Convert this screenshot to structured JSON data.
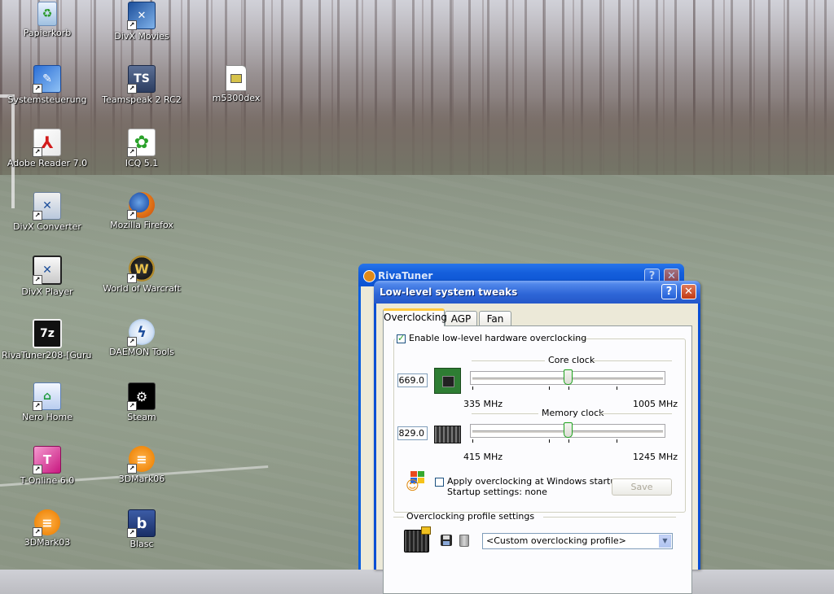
{
  "desktop": {
    "icons": [
      {
        "label": "Papierkorb",
        "icon": "recycle-bin-icon"
      },
      {
        "label": "DivX Movies",
        "icon": "divx-movies-icon"
      },
      {
        "label": "Systemsteuerung",
        "icon": "control-panel-icon"
      },
      {
        "label": "Teamspeak 2 RC2",
        "icon": "teamspeak-icon"
      },
      {
        "label": "m5300dex",
        "icon": "document-icon"
      },
      {
        "label": "Adobe Reader 7.0",
        "icon": "adobe-reader-icon"
      },
      {
        "label": "ICQ 5.1",
        "icon": "icq-flower-icon"
      },
      {
        "label": "DivX Converter",
        "icon": "divx-converter-icon"
      },
      {
        "label": "Mozilla Firefox",
        "icon": "firefox-icon"
      },
      {
        "label": "DivX Player",
        "icon": "divx-player-icon"
      },
      {
        "label": "World of Warcraft",
        "icon": "wow-icon"
      },
      {
        "label": "RivaTuner208-[Guru...",
        "icon": "7z-archive-icon"
      },
      {
        "label": "DAEMON Tools",
        "icon": "daemon-tools-icon"
      },
      {
        "label": "Nero Home",
        "icon": "nero-home-icon"
      },
      {
        "label": "Steam",
        "icon": "steam-icon"
      },
      {
        "label": "T-Online 6.0",
        "icon": "t-online-icon"
      },
      {
        "label": "3DMark06",
        "icon": "3dmark-icon"
      },
      {
        "label": "3DMark03",
        "icon": "3dmark-icon"
      },
      {
        "label": "Blasc",
        "icon": "blasc-icon"
      }
    ]
  },
  "background_window": {
    "title": "RivaTuner",
    "help_glyph": "?",
    "close_glyph": "✕"
  },
  "dialog": {
    "title": "Low-level system tweaks",
    "help_glyph": "?",
    "close_glyph": "✕",
    "tabs": [
      {
        "label": "Overclocking",
        "active": true
      },
      {
        "label": "AGP",
        "active": false
      },
      {
        "label": "Fan",
        "active": false
      }
    ],
    "enable_overclocking": {
      "label": "Enable low-level hardware overclocking",
      "checked": true
    },
    "core_clock": {
      "label": "Core clock",
      "value": "669.0",
      "min_label": "335 MHz",
      "max_label": "1005 MHz",
      "fraction": 0.5
    },
    "memory_clock": {
      "label": "Memory clock",
      "value": "829.0",
      "min_label": "415 MHz",
      "max_label": "1245 MHz",
      "fraction": 0.5
    },
    "apply_startup": {
      "label": "Apply overclocking at Windows startup",
      "checked": false
    },
    "startup_settings": "Startup settings: none",
    "save_button": "Save",
    "profile_section_label": "Overclocking profile settings",
    "profile_select": {
      "selected": "<Custom overclocking profile>"
    },
    "colors": {
      "titlebar": "#2558c9",
      "dialog_bg": "#ece9d8",
      "tab_highlight": "#ffc83c"
    }
  }
}
